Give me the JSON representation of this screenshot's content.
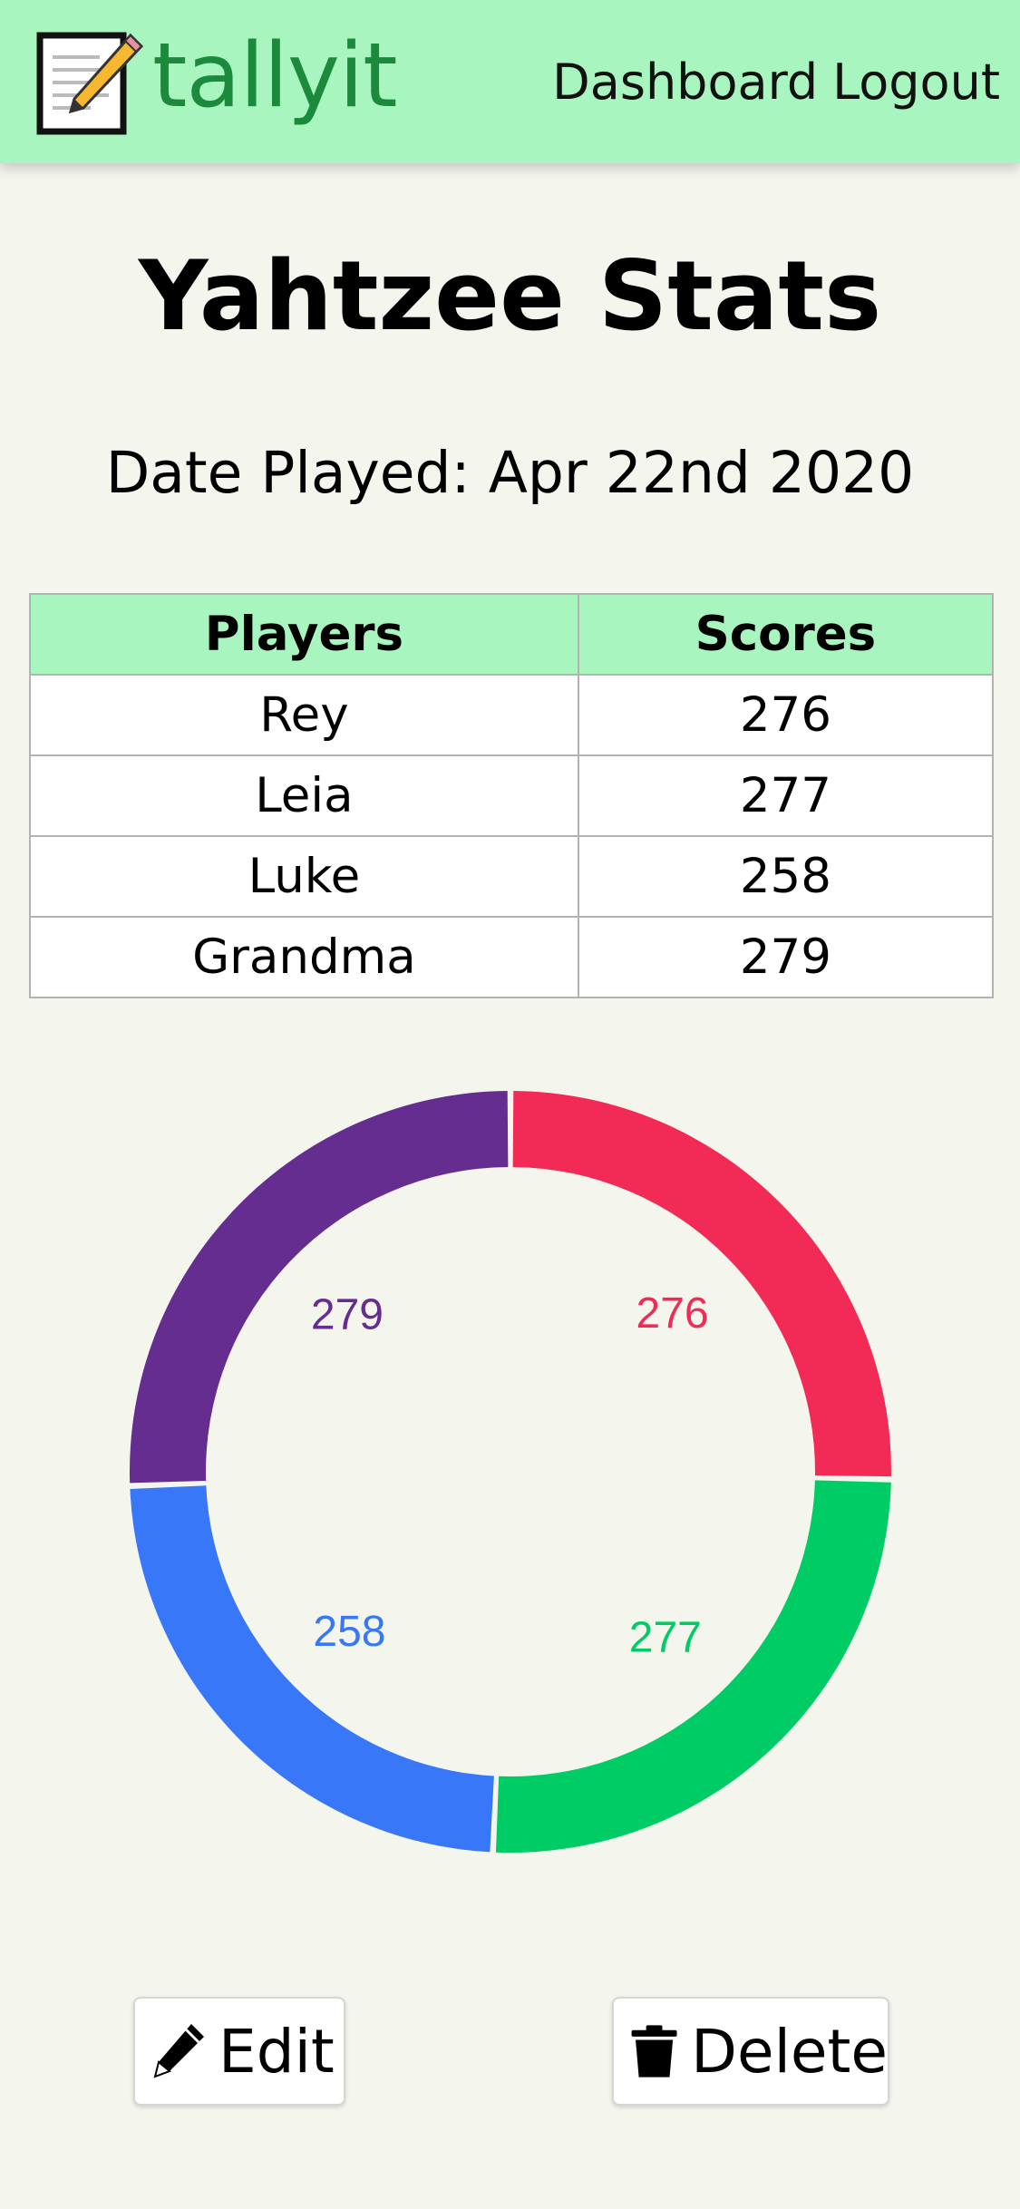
{
  "app": {
    "brand": "tallyit",
    "logo_icon": "notepad-pencil-icon",
    "nav": [
      "Dashboard",
      "Logout"
    ],
    "colors": {
      "navbar": "#a8f5c0",
      "brand_text": "#1b8a3c",
      "background": "#f4f5ec"
    }
  },
  "page": {
    "title": "Yahtzee Stats",
    "date_label": "Date Played:",
    "date_value": "Apr 22nd 2020"
  },
  "table": {
    "headers": [
      "Players",
      "Scores"
    ],
    "rows": [
      [
        "Rey",
        "276"
      ],
      [
        "Leia",
        "277"
      ],
      [
        "Luke",
        "258"
      ],
      [
        "Grandma",
        "279"
      ]
    ]
  },
  "chart_data": {
    "type": "pie",
    "style": "doughnut",
    "categories": [
      "Rey",
      "Leia",
      "Luke",
      "Grandma"
    ],
    "values": [
      276,
      277,
      258,
      279
    ],
    "colors": [
      "#f22b56",
      "#00cc66",
      "#3877f8",
      "#662d91"
    ],
    "data_labels": [
      "276",
      "277",
      "258",
      "279"
    ],
    "legend": "none"
  },
  "actions": {
    "edit": {
      "label": "Edit",
      "icon": "pencil-icon"
    },
    "delete": {
      "label": "Delete",
      "icon": "trash-icon"
    }
  }
}
